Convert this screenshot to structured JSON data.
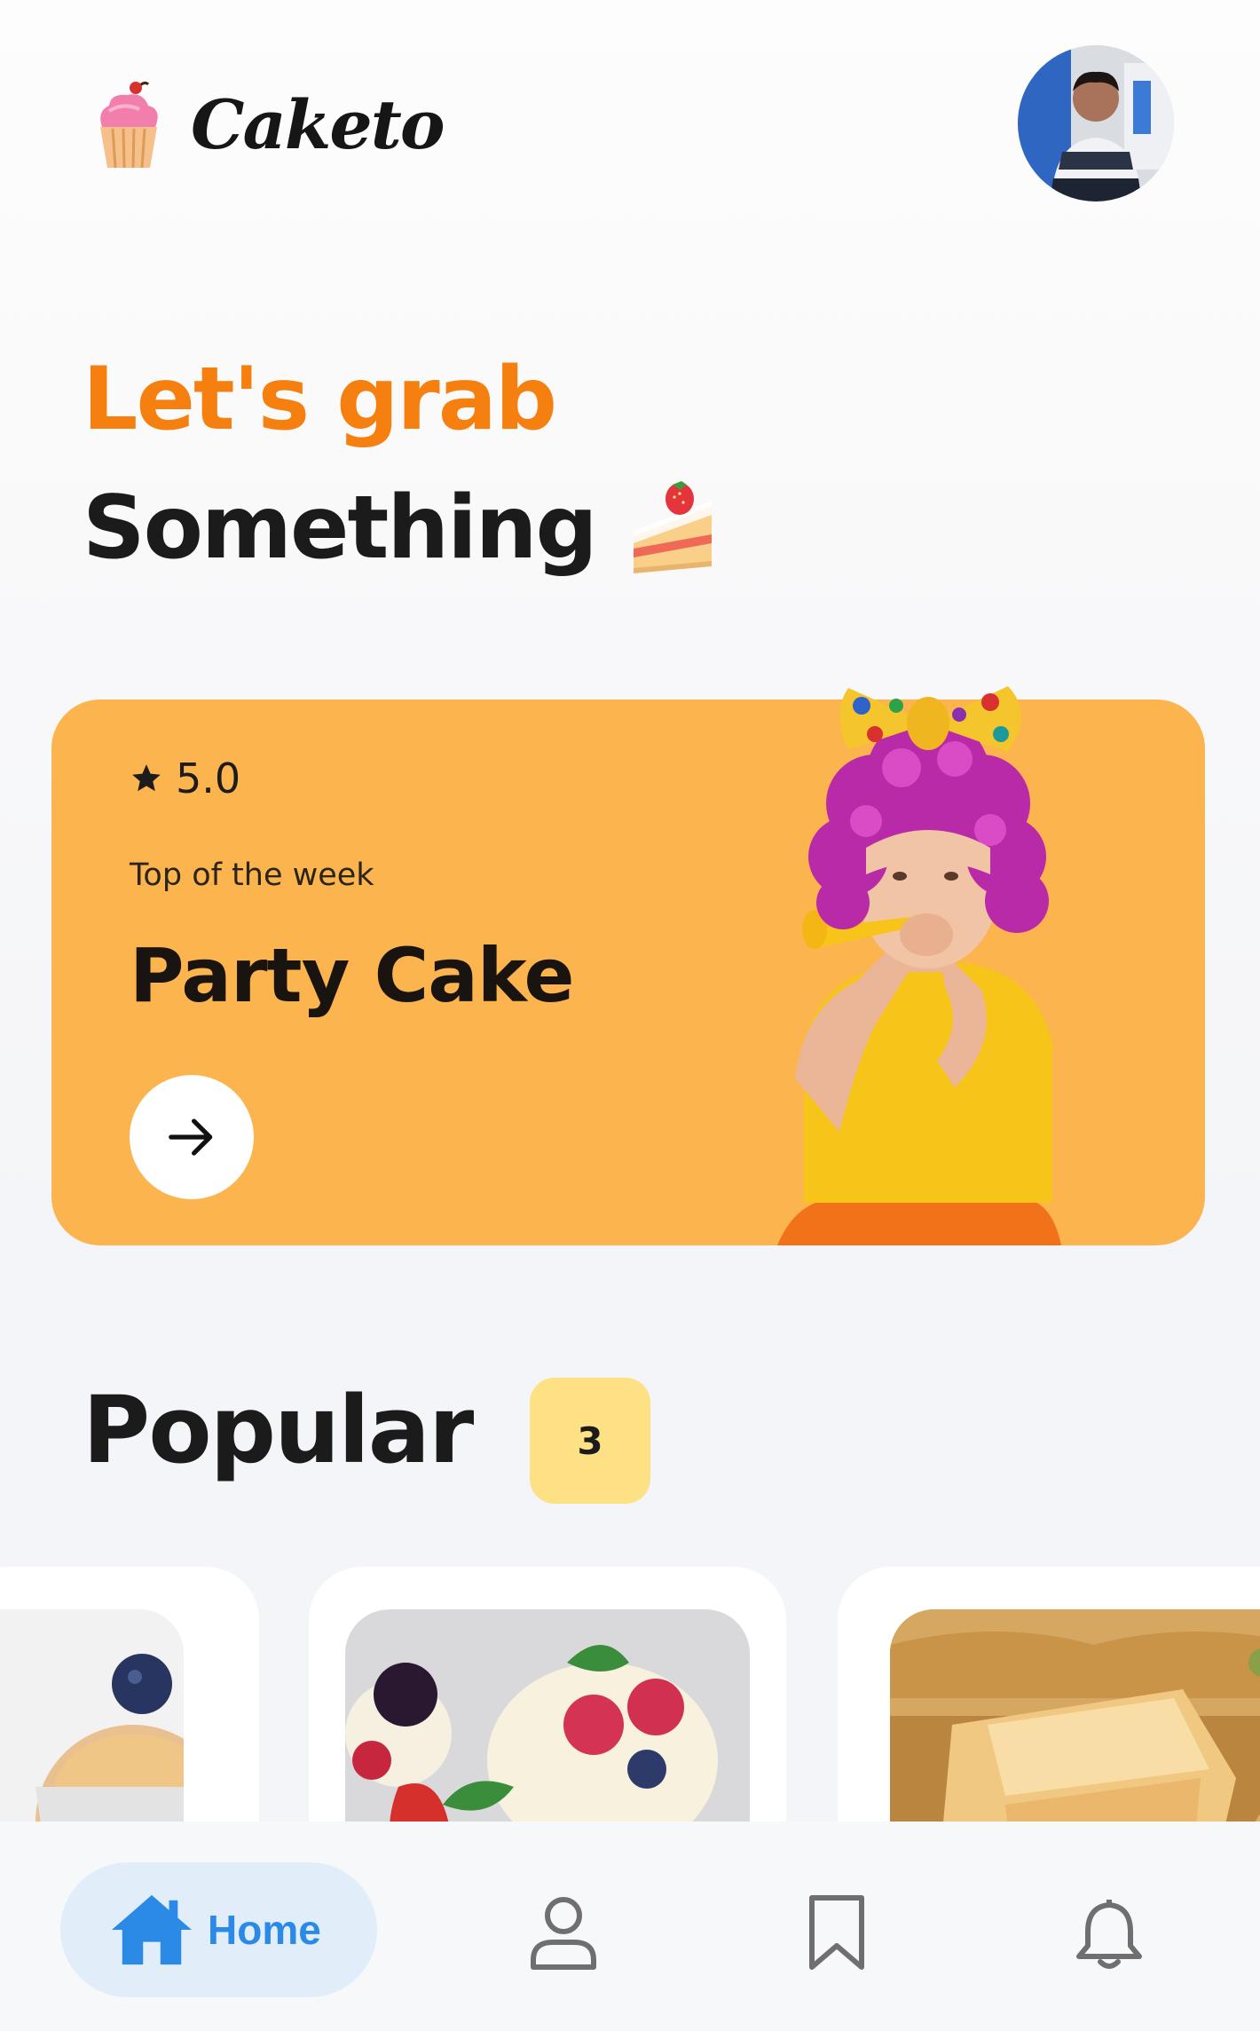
{
  "app": {
    "name": "Caketo",
    "logo_icon": "cupcake-icon",
    "avatar": "user-avatar"
  },
  "hero": {
    "line1": "Let's grab",
    "line2": "Something",
    "line2_icon": "cake-slice-emoji",
    "accent_color": "#f57f0f"
  },
  "promo": {
    "rating_icon": "star-icon",
    "rating": "5.0",
    "subtitle": "Top of the week",
    "title": "Party Cake",
    "button_icon": "arrow-right-icon",
    "background_color": "#fcb44f"
  },
  "popular": {
    "title": "Popular",
    "count": "3",
    "badge_color": "#fde184",
    "items": [
      {
        "image": "blueberry-muffin-photo"
      },
      {
        "image": "berry-cupcakes-photo"
      },
      {
        "image": "baklava-photo"
      }
    ]
  },
  "nav": {
    "active_color": "#2a8ae6",
    "items": [
      {
        "label": "Home",
        "icon": "home-icon",
        "active": true
      },
      {
        "icon": "profile-icon",
        "active": false
      },
      {
        "icon": "bookmark-icon",
        "active": false
      },
      {
        "icon": "bell-icon",
        "active": false
      }
    ]
  }
}
